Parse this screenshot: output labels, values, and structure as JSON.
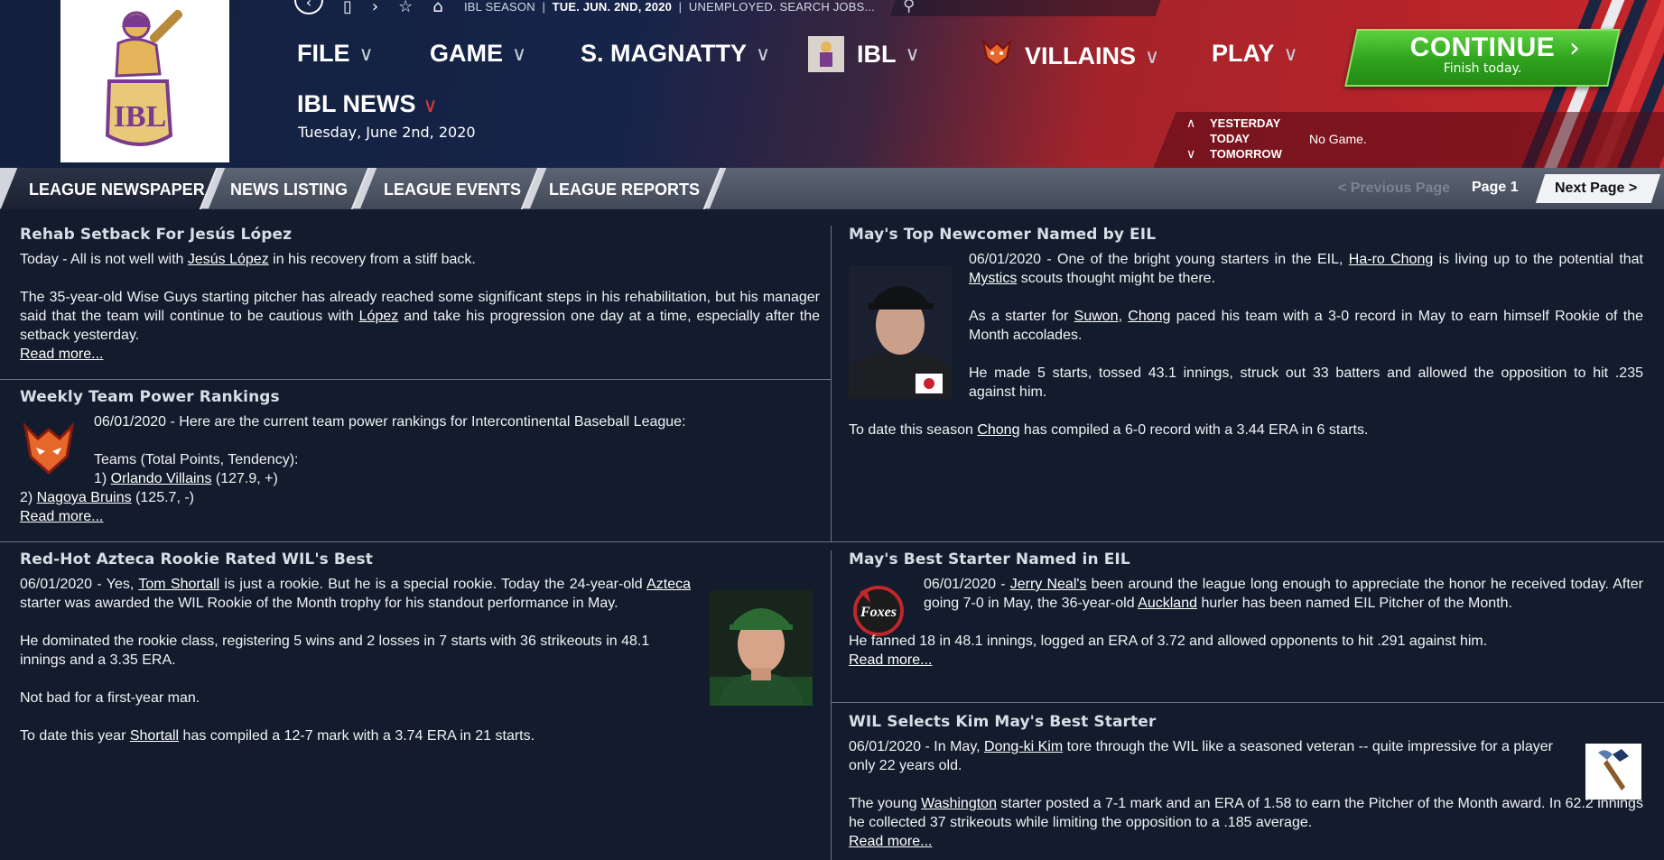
{
  "status": {
    "season": "IBL SEASON",
    "date": "TUE. JUN. 2ND, 2020",
    "job": "UNEMPLOYED. SEARCH JOBS..."
  },
  "menu": {
    "file": "FILE",
    "game": "GAME",
    "manager": "S. MAGNATTY",
    "league": "IBL",
    "team": "VILLAINS",
    "play": "PLAY"
  },
  "continue_btn": {
    "label": "CONTINUE",
    "sub": "Finish today."
  },
  "page": {
    "title": "IBL NEWS",
    "date": "Tuesday, June 2nd, 2020"
  },
  "days": {
    "yesterday": "YESTERDAY",
    "today": "TODAY",
    "tomorrow": "TOMORROW",
    "today_status": "No Game."
  },
  "tabs": [
    "LEAGUE NEWSPAPER",
    "NEWS LISTING",
    "LEAGUE EVENTS",
    "LEAGUE REPORTS"
  ],
  "paging": {
    "prev": "< Previous Page",
    "current": "Page 1",
    "next": "Next Page >"
  },
  "logo": {
    "text": "IBL"
  },
  "stories": {
    "rehab": {
      "title": "Rehab Setback For Jesús López",
      "p1a": "Today - All is not well with ",
      "p1_link": "Jesús López",
      "p1b": " in his recovery from a stiff back.",
      "p2a": "The 35-year-old Wise Guys starting pitcher has already reached some significant steps in his rehabilitation, but his manager said that the team will continue to be cautious with ",
      "p2_link": "López",
      "p2b": " and take his progression one day at a time, especially after the setback yesterday.",
      "read_more": "Read more..."
    },
    "power": {
      "title": "Weekly Team Power Rankings",
      "p1": "06/01/2020 - Here are the current team power rankings for Intercontinental Baseball League:",
      "p2": "Teams (Total Points, Tendency):",
      "r1a": "1) ",
      "r1_link": "Orlando Villains",
      "r1b": " (127.9, +)",
      "r2a": "2) ",
      "r2_link": "Nagoya  Bruins",
      "r2b": " (125.7, -)",
      "read_more": "Read more..."
    },
    "azteca": {
      "title": "Red-Hot Azteca Rookie Rated WIL's Best",
      "p1a": "06/01/2020 - Yes, ",
      "p1_link1": "Tom Shortall",
      "p1b": " is just a rookie. But he is a special rookie. Today the 24-year-old ",
      "p1_link2": "Azteca",
      "p1c": " starter was awarded the WIL Rookie of the Month trophy for his standout performance in May.",
      "p2": "He dominated the rookie class, registering 5 wins and 2 losses in 7 starts with 36 strikeouts in 48.1 innings and a 3.35 ERA.",
      "p3": "Not bad for a first-year man.",
      "p4a": "To date this year ",
      "p4_link": "Shortall",
      "p4b": " has compiled a 12-7 mark with a 3.74 ERA in 21 starts."
    },
    "newcomer": {
      "title": "May's Top Newcomer Named by EIL",
      "p1a": "06/01/2020 - One of the bright young starters in the EIL, ",
      "p1_link1": "Ha-ro Chong",
      "p1b": " is living up to the potential that ",
      "p1_link2": "Mystics",
      "p1c": " scouts thought might be there.",
      "p2a": "As a starter for ",
      "p2_link1": "Suwon",
      "p2b": ", ",
      "p2_link2": "Chong",
      "p2c": " paced his team with a 3-0 record in May to earn himself Rookie of the Month accolades.",
      "p3": "He made 5 starts, tossed 43.1 innings, struck out 33 batters and allowed the opposition to hit .235 against him.",
      "p4a": "To date this season ",
      "p4_link": "Chong",
      "p4b": " has compiled a 6-0 record with a 3.44 ERA in 6 starts."
    },
    "beststarter": {
      "title": "May's Best Starter Named in EIL",
      "p1a": "06/01/2020 - ",
      "p1_link1": "Jerry Neal's",
      "p1b": " been around the league long enough to appreciate the honor he received today. After going 7-0 in May, the 36-year-old ",
      "p1_link2": "Auckland",
      "p1c": " hurler has been named EIL Pitcher of the Month.",
      "p2": "He fanned 18 in 48.1 innings, logged an ERA of 3.72 and allowed opponents to hit .291 against him.",
      "read_more": "Read more...",
      "logo_text": "Foxes"
    },
    "kim": {
      "title": "WIL Selects Kim May's Best Starter",
      "p1a": "06/01/2020 - In May, ",
      "p1_link": "Dong-ki Kim",
      "p1b": " tore through the WIL like a seasoned veteran -- quite impressive for a player only 22 years old.",
      "p2a": "The young ",
      "p2_link": "Washington",
      "p2b": " starter posted a 7-1 mark and an ERA of 1.58 to earn the Pitcher of the Month award. In 62.2 innings he collected 37 strikeouts while limiting the opposition to a .185 average.",
      "read_more": "Read more..."
    }
  },
  "colors": {
    "header_blue": "#16244a",
    "header_red": "#c6262b",
    "continue_green": "#2fa21e",
    "content_bg": "#121c2c"
  }
}
